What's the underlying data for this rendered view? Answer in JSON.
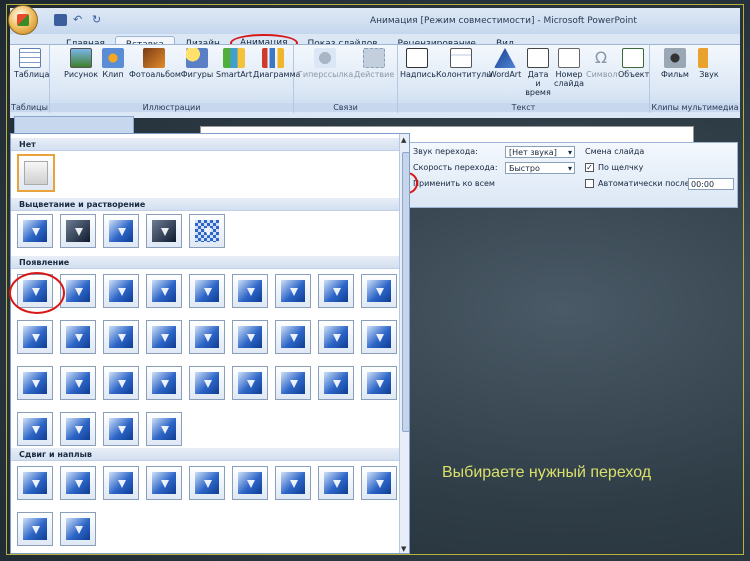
{
  "window": {
    "title": "Анимация [Режим совместимости] - Microsoft PowerPoint"
  },
  "tabs": [
    "Главная",
    "Вставка",
    "Дизайн",
    "Анимация",
    "Показ слайдов",
    "Рецензирование",
    "Вид"
  ],
  "ribbon": {
    "groups": [
      "Таблицы",
      "Иллюстрации",
      "Связи",
      "Текст",
      "Клипы мультимедиа"
    ],
    "buttons": [
      "Таблица",
      "Рисунок",
      "Клип",
      "Фотоальбом",
      "Фигуры",
      "SmartArt",
      "Диаграмма",
      "Гиперссылка",
      "Действие",
      "Надпись",
      "Колонтитулы",
      "WordArt",
      "Дата и время",
      "Номер слайда",
      "Символ",
      "Объект",
      "Фильм",
      "Звук"
    ]
  },
  "transition": {
    "sound_label": "Звук перехода:",
    "sound_value": "[Нет звука]",
    "speed_label": "Скорость перехода:",
    "speed_value": "Быстро",
    "apply_all": "Применить ко всем",
    "advance_header": "Смена слайда",
    "on_click": "По щелчку",
    "auto_after": "Автоматически после:",
    "time": "00:00"
  },
  "gallery": {
    "sections": [
      "Нет",
      "Выцветание и растворение",
      "Появление",
      "Сдвиг и наплыв"
    ]
  },
  "caption": "Выбираете нужный переход"
}
